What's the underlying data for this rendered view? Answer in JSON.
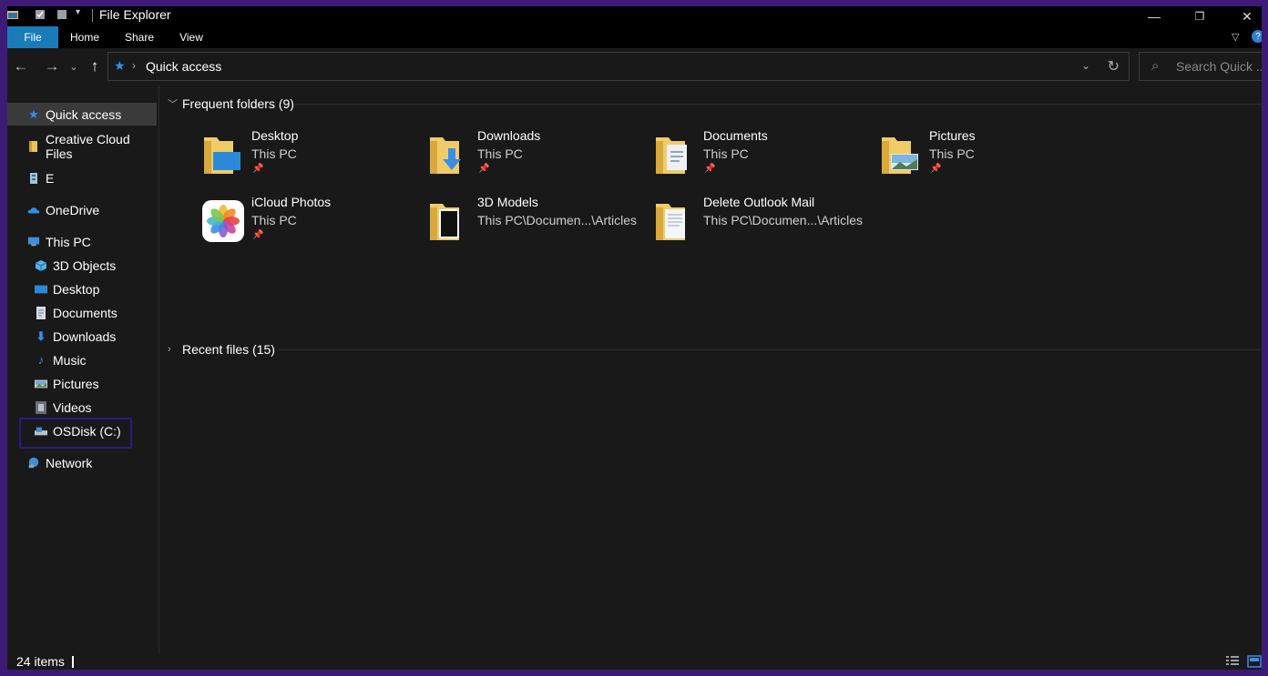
{
  "window": {
    "title": "File Explorer",
    "accent": "#1a7bb9"
  },
  "ribbon": {
    "tabs": [
      "File",
      "Home",
      "Share",
      "View"
    ]
  },
  "address": {
    "path": "Quick access"
  },
  "search": {
    "placeholder": "Search Quick ..."
  },
  "sidebar": {
    "items": [
      {
        "label": "Quick access",
        "icon": "star-icon"
      },
      {
        "label": "Creative Cloud Files",
        "icon": "cloud-folder-icon"
      },
      {
        "label": "E",
        "icon": "drive-icon"
      },
      {
        "label": "OneDrive",
        "icon": "onedrive-icon"
      },
      {
        "label": "This PC",
        "icon": "computer-icon"
      },
      {
        "label": "3D Objects",
        "icon": "cube-icon"
      },
      {
        "label": "Desktop",
        "icon": "desktop-icon"
      },
      {
        "label": "Documents",
        "icon": "document-icon"
      },
      {
        "label": "Downloads",
        "icon": "download-icon"
      },
      {
        "label": "Music",
        "icon": "music-icon"
      },
      {
        "label": "Pictures",
        "icon": "pictures-icon"
      },
      {
        "label": "Videos",
        "icon": "video-icon"
      },
      {
        "label": "OSDisk (C:)",
        "icon": "disk-icon"
      },
      {
        "label": "Network",
        "icon": "network-icon"
      }
    ]
  },
  "groups": {
    "frequent": {
      "label": "Frequent folders",
      "count": "(9)",
      "folders": [
        {
          "name": "Desktop",
          "location": "This PC",
          "pinned": true,
          "icon": "desktop-folder-icon"
        },
        {
          "name": "Downloads",
          "location": "This PC",
          "pinned": true,
          "icon": "downloads-folder-icon"
        },
        {
          "name": "Documents",
          "location": "This PC",
          "pinned": true,
          "icon": "documents-folder-icon"
        },
        {
          "name": "Pictures",
          "location": "This PC",
          "pinned": true,
          "icon": "pictures-folder-icon"
        },
        {
          "name": "iCloud Photos",
          "location": "This PC",
          "pinned": true,
          "icon": "icloud-photos-icon"
        },
        {
          "name": "3D Models",
          "location": "This PC\\Documen...\\Articles",
          "pinned": false,
          "icon": "folder-icon"
        },
        {
          "name": "Delete Outlook Mail",
          "location": "This PC\\Documen...\\Articles",
          "pinned": false,
          "icon": "folder-icon"
        }
      ]
    },
    "recent": {
      "label": "Recent files",
      "count": "(15)"
    }
  },
  "status": {
    "item_count": "24 items"
  }
}
